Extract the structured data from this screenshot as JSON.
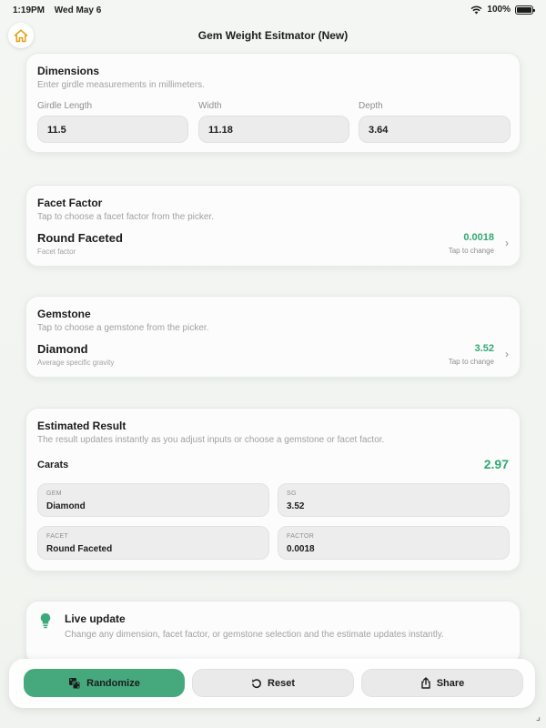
{
  "status": {
    "time": "1:19PM",
    "date": "Wed May 6",
    "battery": "100%",
    "battery_level": 1.0
  },
  "nav": {
    "title": "Gem Weight Esitmator (New)"
  },
  "dimensions": {
    "title": "Dimensions",
    "subtitle": "Enter girdle measurements in millimeters.",
    "fields": [
      {
        "label": "Girdle Length",
        "value": "11.5"
      },
      {
        "label": "Width",
        "value": "11.18"
      },
      {
        "label": "Depth",
        "value": "3.64"
      }
    ]
  },
  "facet": {
    "title": "Facet Factor",
    "subtitle": "Tap to choose a facet factor from the picker.",
    "name": "Round Faceted",
    "caption": "Facet factor",
    "value": "0.0018",
    "hint": "Tap to change"
  },
  "gemstone": {
    "title": "Gemstone",
    "subtitle": "Tap to choose a gemstone from the picker.",
    "name": "Diamond",
    "caption": "Average specific gravity",
    "value": "3.52",
    "hint": "Tap to change"
  },
  "result": {
    "title": "Estimated Result",
    "subtitle": "The result updates instantly as you adjust inputs or choose a gemstone or facet factor.",
    "carats_label": "Carats",
    "carats_value": "2.97",
    "tiles": [
      {
        "key": "GEM",
        "value": "Diamond"
      },
      {
        "key": "SG",
        "value": "3.52"
      },
      {
        "key": "FACET",
        "value": "Round Faceted"
      },
      {
        "key": "FACTOR",
        "value": "0.0018"
      }
    ]
  },
  "live": {
    "title": "Live update",
    "text": "Change any dimension, facet factor, or gemstone selection and the estimate updates instantly."
  },
  "actions": {
    "randomize": "Randomize",
    "reset": "Reset",
    "share": "Share"
  },
  "colors": {
    "accent": "#34a874",
    "primary_button": "#45a97d",
    "home_icon": "#e3a21a"
  },
  "icons": [
    "home-icon",
    "dice-icon",
    "reset-icon",
    "share-icon",
    "lightbulb-icon",
    "chevron-right-icon",
    "wifi-icon",
    "battery-icon"
  ]
}
